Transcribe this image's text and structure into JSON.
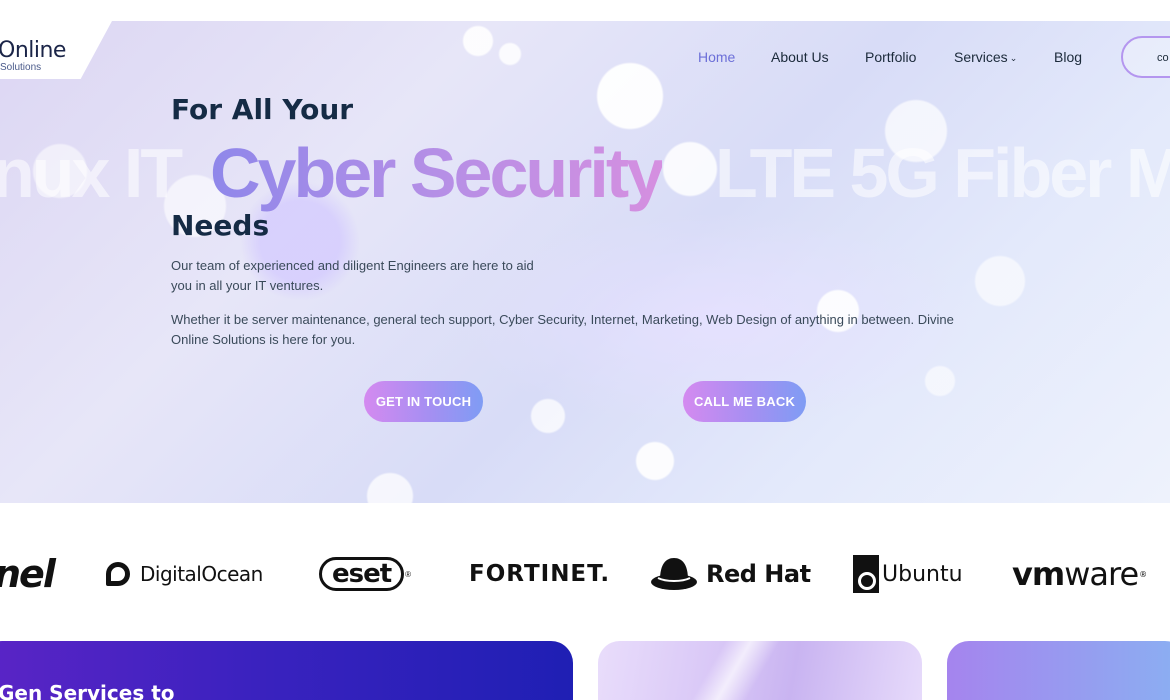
{
  "brand": {
    "logo_text": "Online",
    "logo_subtext": "Solutions"
  },
  "nav": {
    "items": [
      {
        "label": "Home",
        "active": true
      },
      {
        "label": "About Us",
        "active": false
      },
      {
        "label": "Portfolio",
        "active": false
      },
      {
        "label": "Services",
        "active": false,
        "has_dropdown": true
      },
      {
        "label": "Blog",
        "active": false
      }
    ],
    "contact_label": "co",
    "dropdown_icon": "chevron-down-icon"
  },
  "hero": {
    "heading_top": "For All Your",
    "rotating_words": [
      "nux IT",
      "Cyber Security",
      "LTE 5G Fiber M"
    ],
    "heading_bottom": "Needs",
    "paragraph_1": "Our team of experienced and diligent Engineers are here to aid you in all your IT ventures.",
    "paragraph_2": "Whether it be server maintenance, general tech support, Cyber Security, Internet, Marketing, Web Design of anything in between. Divine Online Solutions is here for you.",
    "cta_primary": "GET IN TOUCH",
    "cta_secondary": "CALL ME BACK"
  },
  "partners": [
    {
      "name": "cpanel",
      "text": "nel"
    },
    {
      "name": "digitalocean",
      "text": "DigitalOcean"
    },
    {
      "name": "eset",
      "text": "eset",
      "mark": "®"
    },
    {
      "name": "fortinet",
      "text": "FORTINET."
    },
    {
      "name": "redhat",
      "text": "Red Hat"
    },
    {
      "name": "ubuntu",
      "text": "Ubuntu"
    },
    {
      "name": "vmware",
      "text_bold": "vm",
      "text_regular": "ware",
      "mark": "®"
    }
  ],
  "cards": {
    "card_1_title": "Gen Services to"
  },
  "colors": {
    "accent": "#6c6fd8",
    "heading": "#152b45",
    "button_gradient_start": "#d48af0",
    "button_gradient_end": "#7f9cf4",
    "card_dark": "#3b22bf"
  }
}
